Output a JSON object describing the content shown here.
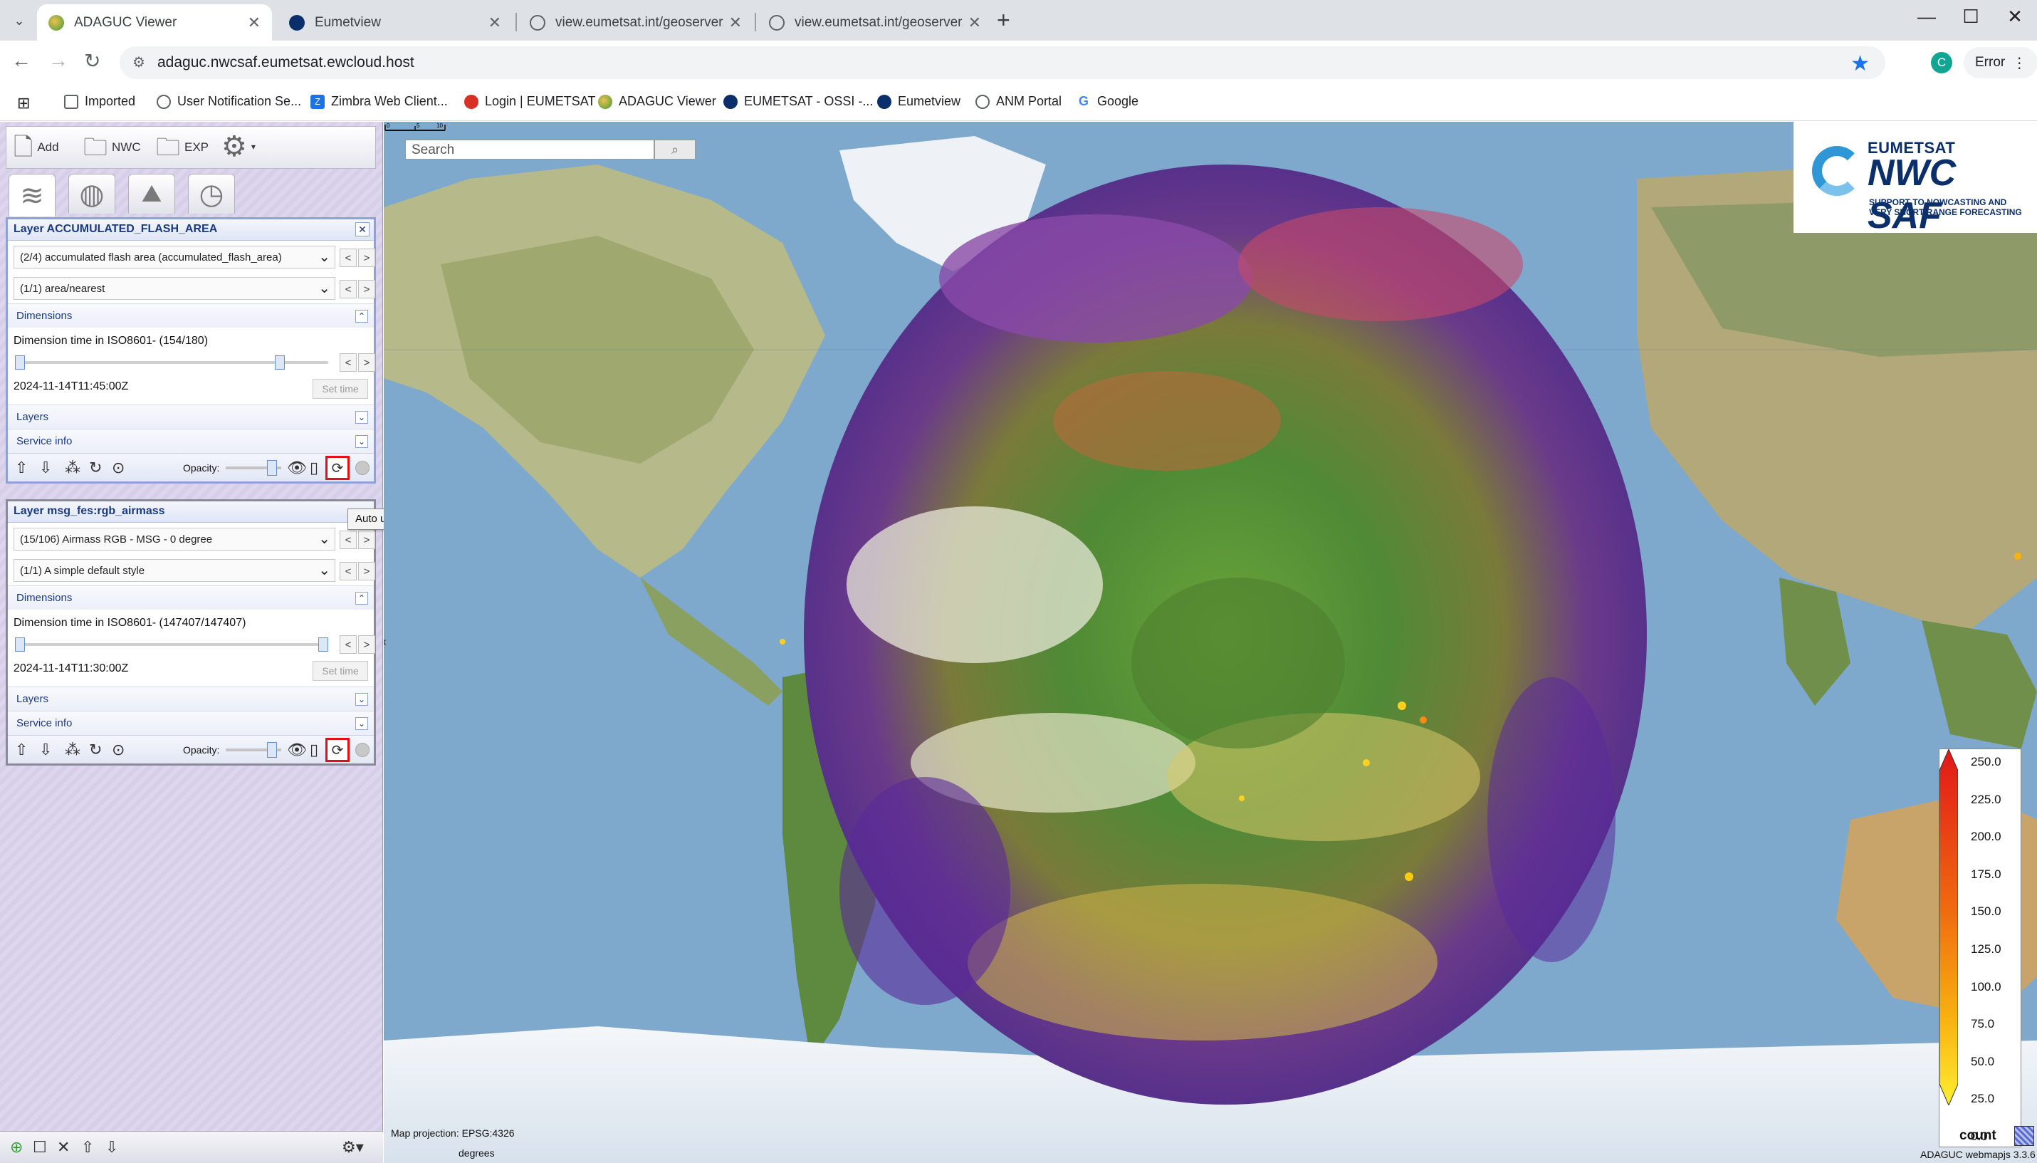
{
  "browser": {
    "tabs": [
      {
        "title": "ADAGUC Viewer",
        "active": true
      },
      {
        "title": "Eumetview",
        "active": false
      },
      {
        "title": "view.eumetsat.int/geoserver/wr",
        "active": false
      },
      {
        "title": "view.eumetsat.int/geoserver/wr",
        "active": false
      }
    ],
    "url": "adaguc.nwcsaf.eumetsat.ewcloud.host",
    "profile_initial": "C",
    "error_label": "Error",
    "bookmarks": [
      "Imported",
      "User Notification Se...",
      "Zimbra Web Client...",
      "Login | EUMETSAT",
      "ADAGUC Viewer",
      "EUMETSAT - OSSI -...",
      "Eumetview",
      "ANM Portal",
      "Google"
    ]
  },
  "toolbar": {
    "add_label": "Add",
    "nwc_label": "NWC",
    "exp_label": "EXP"
  },
  "layers": [
    {
      "title": "Layer ACCUMULATED_FLASH_AREA",
      "variable": "(2/4) accumulated flash area (accumulated_flash_area)",
      "style": "(1/1) area/nearest",
      "dimensions_label": "Dimensions",
      "dimension_text": "Dimension time in ISO8601- (154/180)",
      "slider_fraction": 0.855,
      "time": "2024-11-14T11:45:00Z",
      "set_time_label": "Set time",
      "layers_label": "Layers",
      "service_info_label": "Service info",
      "opacity_label": "Opacity:"
    },
    {
      "title": "Layer msg_fes:rgb_airmass",
      "variable": "(15/106) Airmass RGB - MSG - 0 degree",
      "style": "(1/1) A simple default style",
      "dimensions_label": "Dimensions",
      "dimension_text": "Dimension time in ISO8601- (147407/147407)",
      "slider_fraction": 1.0,
      "time": "2024-11-14T11:30:00Z",
      "set_time_label": "Set time",
      "layers_label": "Layers",
      "service_info_label": "Service info",
      "opacity_label": "Opacity:"
    }
  ],
  "tooltip": "Auto update on/off",
  "map": {
    "search_placeholder": "Search",
    "projection_text": "Map projection: EPSG:4326",
    "scale_unit": "degrees",
    "scale_ticks": [
      "0",
      "5",
      "10"
    ],
    "version_text": "ADAGUC webmapjs 3.3.6",
    "logo": {
      "brand": "EUMETSAT",
      "title": "NWC SAF",
      "sub1": "SUPPORT TO NOWCASTING AND",
      "sub2": "VERY SHORT RANGE FORECASTING"
    },
    "legend": {
      "unit": "count",
      "ticks": [
        "250.0",
        "225.0",
        "200.0",
        "175.0",
        "150.0",
        "125.0",
        "100.0",
        "75.0",
        "50.0",
        "25.0",
        "0.0"
      ]
    }
  }
}
